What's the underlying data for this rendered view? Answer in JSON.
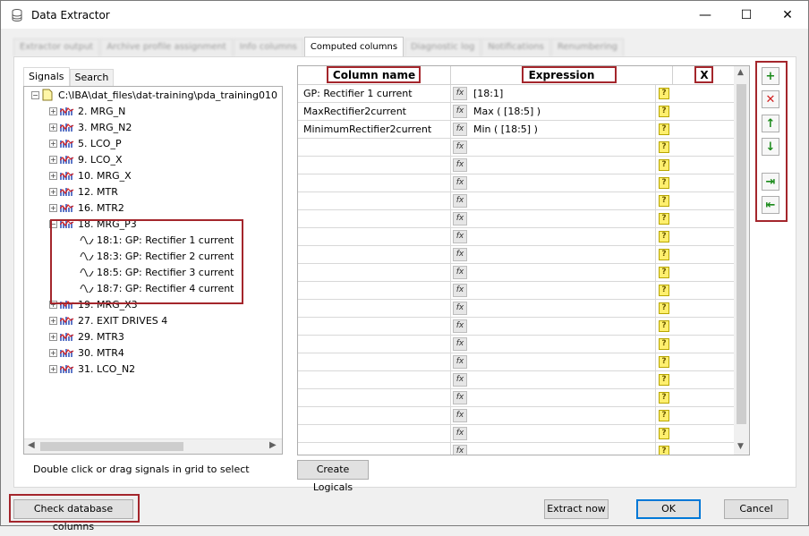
{
  "window": {
    "title": "Data Extractor",
    "minimize": "—",
    "maximize": "☐",
    "close": "✕"
  },
  "tabs": [
    {
      "label": "Extractor output",
      "active": false
    },
    {
      "label": "Archive profile assignment",
      "active": false
    },
    {
      "label": "Info columns",
      "active": false
    },
    {
      "label": "Computed columns",
      "active": true
    },
    {
      "label": "Diagnostic log",
      "active": false
    },
    {
      "label": "Notifications",
      "active": false
    },
    {
      "label": "Renumbering",
      "active": false
    }
  ],
  "left_tabs": [
    {
      "label": "Signals",
      "active": true
    },
    {
      "label": "Search",
      "active": false
    }
  ],
  "tree": {
    "root": "C:\\IBA\\dat_files\\dat-training\\pda_training010",
    "groups": [
      {
        "label": "2. MRG_N"
      },
      {
        "label": "3. MRG_N2"
      },
      {
        "label": "5. LCO_P"
      },
      {
        "label": "9. LCO_X"
      },
      {
        "label": "10. MRG_X"
      },
      {
        "label": "12. MTR"
      },
      {
        "label": "16. MTR2"
      },
      {
        "label": "18. MRG_P3",
        "expanded": true,
        "children": [
          "18:1: GP: Rectifier 1 current",
          "18:3: GP: Rectifier 2 current",
          "18:5: GP: Rectifier 3 current",
          "18:7: GP: Rectifier 4 current"
        ]
      },
      {
        "label": "19. MRG_X3"
      },
      {
        "label": "27. EXIT DRIVES 4"
      },
      {
        "label": "29. MTR3"
      },
      {
        "label": "30. MTR4"
      },
      {
        "label": "31. LCO_N2"
      }
    ]
  },
  "hint": "Double click or drag signals in grid to select",
  "grid": {
    "headers": {
      "name": "Column name",
      "expression": "Expression",
      "x": "X"
    },
    "rows": [
      {
        "name": "GP: Rectifier 1 current",
        "expression": "[18:1]"
      },
      {
        "name": "MaxRectifier2current",
        "expression": "Max ( [18:5] )"
      },
      {
        "name": "MinimumRectifier2current",
        "expression": "Min ( [18:5] )"
      },
      {
        "name": "",
        "expression": ""
      },
      {
        "name": "",
        "expression": ""
      },
      {
        "name": "",
        "expression": ""
      },
      {
        "name": "",
        "expression": ""
      },
      {
        "name": "",
        "expression": ""
      },
      {
        "name": "",
        "expression": ""
      },
      {
        "name": "",
        "expression": ""
      },
      {
        "name": "",
        "expression": ""
      },
      {
        "name": "",
        "expression": ""
      },
      {
        "name": "",
        "expression": ""
      },
      {
        "name": "",
        "expression": ""
      },
      {
        "name": "",
        "expression": ""
      },
      {
        "name": "",
        "expression": ""
      },
      {
        "name": "",
        "expression": ""
      },
      {
        "name": "",
        "expression": ""
      },
      {
        "name": "",
        "expression": ""
      },
      {
        "name": "",
        "expression": ""
      },
      {
        "name": "",
        "expression": ""
      }
    ],
    "fx_label": "fx",
    "q_label": "?"
  },
  "side_buttons": [
    {
      "name": "add-row-button",
      "glyph": "+",
      "color": "#1a8a1a"
    },
    {
      "name": "delete-row-button",
      "glyph": "✕",
      "color": "#d11f1f"
    },
    {
      "name": "move-up-button",
      "glyph": "↑",
      "color": "#1a8a1a"
    },
    {
      "name": "move-down-button",
      "glyph": "↓",
      "color": "#1a8a1a"
    },
    {
      "name": "import-button",
      "glyph": "⇥",
      "color": "#1a8a1a"
    },
    {
      "name": "export-button",
      "glyph": "⇤",
      "color": "#1a8a1a"
    }
  ],
  "buttons": {
    "create_logicals": "Create Logicals",
    "check_db": "Check database columns",
    "extract_now": "Extract now",
    "ok": "OK",
    "cancel": "Cancel"
  }
}
